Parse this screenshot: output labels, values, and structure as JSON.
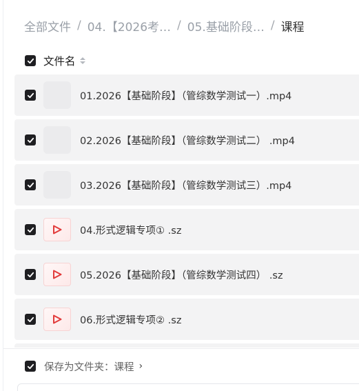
{
  "breadcrumb": {
    "items": [
      "全部文件",
      "04.【2026考…",
      "05.基础阶段…"
    ],
    "current": "课程",
    "separator": "/"
  },
  "header": {
    "column_label": "文件名",
    "all_checked": true
  },
  "files": [
    {
      "name": "01.2026【基础阶段】（管综数学测试一）.mp4",
      "type": "mp4",
      "checked": true
    },
    {
      "name": "02.2026【基础阶段】（管综数学测试二） .mp4",
      "type": "mp4",
      "checked": true
    },
    {
      "name": "03.2026【基础阶段】（管综数学测试三）.mp4",
      "type": "mp4",
      "checked": true
    },
    {
      "name": "04.形式逻辑专项① .sz",
      "type": "sz",
      "checked": true
    },
    {
      "name": "05.2026【基础阶段】（管综数学测试四） .sz",
      "type": "sz",
      "checked": true
    },
    {
      "name": "06.形式逻辑专项② .sz",
      "type": "sz",
      "checked": true
    }
  ],
  "footer": {
    "save_label": "保存为文件夹：课程",
    "chevron": "›",
    "checked": true
  },
  "colors": {
    "checkbox": "#1f1f22",
    "row_bg": "#f3f3f4",
    "video_icon": "#e23b3b"
  }
}
